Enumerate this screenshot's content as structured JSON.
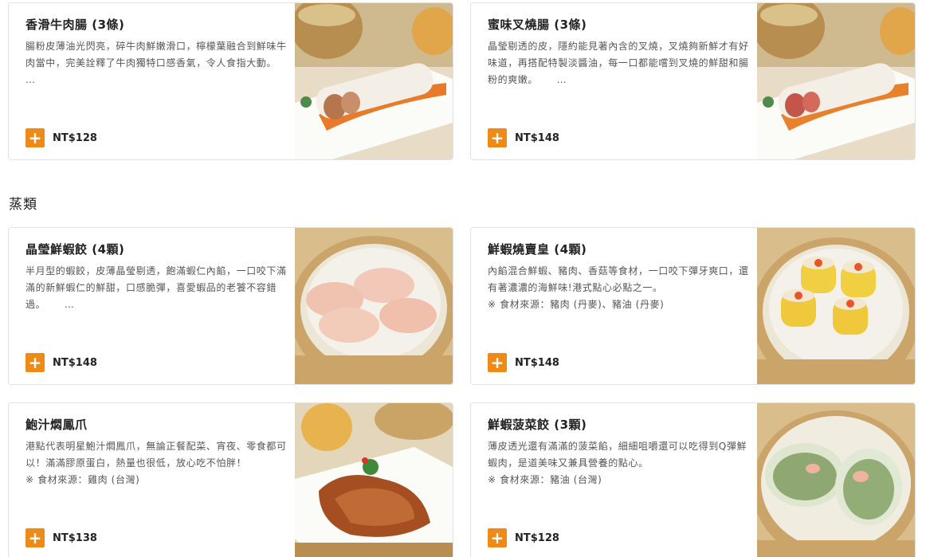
{
  "sections": [
    {
      "title": "",
      "items": [
        {
          "name": "香滑牛肉腸 (3條)",
          "desc": "腸粉皮薄油光閃亮，碎牛肉鮮嫩滑口，檸檬葉融合到鮮味牛肉當中，完美詮釋了牛肉獨特口感香氣，令人食指大動。　 …",
          "price": "NT$128",
          "add": "+"
        },
        {
          "name": "蜜味叉燒腸 (3條)",
          "desc": "晶瑩剔透的皮，隱約能見著內含的叉燒，叉燒夠新鮮才有好味道，再搭配特製淡醬油，每一口都能嚐到叉燒的鮮甜和腸粉的爽嫩。　　 …",
          "price": "NT$148",
          "add": "+"
        }
      ]
    },
    {
      "title": "蒸類",
      "items": [
        {
          "name": "晶瑩鮮蝦餃 (4顆)",
          "desc": "半月型的蝦餃，皮薄晶瑩剔透，飽滿蝦仁內餡，一口咬下滿滿的新鮮蝦仁的鮮甜，口感脆彈，喜愛蝦品的老饕不容錯過。　　 …",
          "price": "NT$148",
          "add": "+"
        },
        {
          "name": "鮮蝦燒賣皇 (4顆)",
          "desc": "內餡混合鮮蝦、豬肉、香菇等食材，一口咬下彈牙爽口，還有著濃濃的海鮮味!港式點心必點之一。",
          "source": "※ 食材來源：豬肉 (丹麥)、豬油 (丹麥)",
          "price": "NT$148",
          "add": "+"
        },
        {
          "name": "鮑汁燜鳳爪",
          "desc": "港點代表明星鮑汁燜鳳爪，無論正餐配菜、宵夜、零食都可以！滿滿膠原蛋白，熱量也很低，放心吃不怕胖！",
          "source": "※ 食材來源：雞肉 (台灣)",
          "price": "NT$138",
          "add": "+"
        },
        {
          "name": "鮮蝦菠菜餃 (3顆)",
          "desc": "薄皮透光還有滿滿的菠菜餡，細細咀嚼還可以吃得到Q彈鮮蝦肉，是道美味又兼具營養的點心。",
          "source": "※ 食材來源：豬油 (台灣)",
          "price": "NT$128",
          "add": "+"
        }
      ]
    }
  ],
  "colors": {
    "accent": "#f08a16",
    "border": "#e2e2e2",
    "text": "#222222",
    "muted": "#555555"
  },
  "icons": {
    "add": "plus-icon"
  }
}
